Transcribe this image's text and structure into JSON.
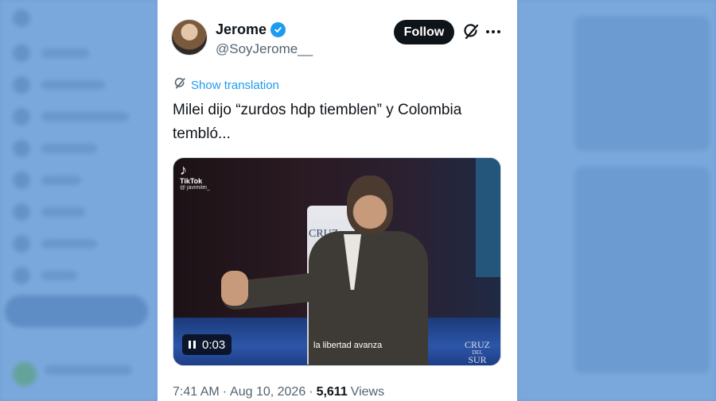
{
  "tweet": {
    "display_name": "Jerome",
    "handle": "@SoyJerome__",
    "follow_label": "Follow",
    "translate_label": "Show translation",
    "text": "Milei dijo “zurdos hdp tiemblen” y Colombia tembló...",
    "video": {
      "tiktok_label": "TikTok",
      "tiktok_user": "@ javimilei_",
      "timestamp": "0:03",
      "subtitle": "la libertad avanza",
      "banner_text": "CRUZ",
      "watermark_line1": "CRUZ",
      "watermark_line2": "DEL",
      "watermark_line3": "SUR"
    },
    "time": "7:41 AM",
    "separator": "·",
    "date": "Aug 10, 2026",
    "views_count": "5,611",
    "views_label": "Views"
  },
  "icons": {
    "verified": "verified-badge-icon",
    "grok": "grok-icon",
    "more": "more-icon",
    "translate": "translate-icon",
    "pause": "pause-icon"
  },
  "colors": {
    "accent": "#1d9bf0",
    "text_primary": "#0f1419",
    "text_secondary": "#536471",
    "backdrop": "#6f9fd6"
  }
}
